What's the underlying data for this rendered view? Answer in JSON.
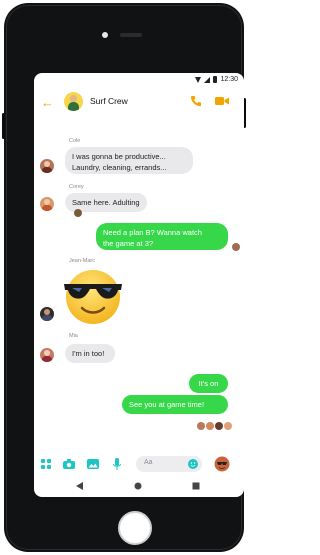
{
  "status_bar": {
    "time": "12:30"
  },
  "header": {
    "title": "Surf Crew"
  },
  "messages": [
    {
      "sender": "Cole",
      "text_line1": "I was gonna be productive...",
      "text_line2": "Laundry, cleaning, errands..."
    },
    {
      "sender": "Corey",
      "text": "Same here. Adulting"
    },
    {
      "text_line1": "Need a plan B? Wanna watch",
      "text_line2": "the game at 3?"
    },
    {
      "sender": "Jean-Marc"
    },
    {
      "sender": "Mia",
      "text": "I'm in too!"
    },
    {
      "text": "It's on"
    },
    {
      "text": "See you at game time!"
    }
  ],
  "composer": {
    "placeholder": "Aa"
  },
  "colors": {
    "accent": "#f2a400",
    "outgoing_bubble": "#36d84a",
    "icons": "#1ec5c5"
  },
  "icons": [
    "back-arrow-icon",
    "phone-icon",
    "video-camera-icon",
    "apps-icon",
    "camera-icon",
    "image-icon",
    "microphone-icon",
    "emoji-icon",
    "nav-back-icon",
    "nav-home-icon",
    "nav-recents-icon"
  ]
}
